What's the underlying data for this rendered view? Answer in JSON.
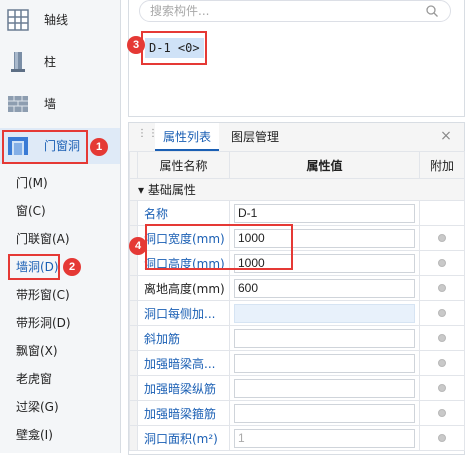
{
  "sidebar": {
    "categories": [
      {
        "label": "轴线",
        "icon": "grid-axis-icon"
      },
      {
        "label": "柱",
        "icon": "column-icon"
      },
      {
        "label": "墙",
        "icon": "wall-icon"
      },
      {
        "label": "门窗洞",
        "icon": "door-window-icon"
      }
    ],
    "items": [
      {
        "label": "门(M)"
      },
      {
        "label": "窗(C)"
      },
      {
        "label": "门联窗(A)"
      },
      {
        "label": "墙洞(D)"
      },
      {
        "label": "带形窗(C)"
      },
      {
        "label": "带形洞(D)"
      },
      {
        "label": "飘窗(X)"
      },
      {
        "label": "老虎窗"
      },
      {
        "label": "过梁(G)"
      },
      {
        "label": "壁龛(I)"
      }
    ]
  },
  "search": {
    "placeholder": "搜索构件..."
  },
  "component_list": [
    {
      "label": "D-1 <0>"
    }
  ],
  "property_panel": {
    "tabs": [
      {
        "label": "属性列表"
      },
      {
        "label": "图层管理"
      }
    ],
    "close_glyph": "×",
    "headers": {
      "name": "属性名称",
      "value": "属性值",
      "extra": "附加"
    },
    "group_toggle": "▾",
    "group_label": "基础属性",
    "rows": [
      {
        "name": "名称",
        "value": "D-1"
      },
      {
        "name": "洞口宽度(mm)",
        "value": "1000"
      },
      {
        "name": "洞口高度(mm)",
        "value": "1000"
      },
      {
        "name": "离地高度(mm)",
        "value": "600"
      },
      {
        "name": "洞口每侧加...",
        "value": ""
      },
      {
        "name": "斜加筋",
        "value": ""
      },
      {
        "name": "加强暗梁高...",
        "value": ""
      },
      {
        "name": "加强暗梁纵筋",
        "value": ""
      },
      {
        "name": "加强暗梁箍筋",
        "value": ""
      },
      {
        "name": "洞口面积(m²)",
        "value": "1"
      }
    ]
  },
  "annotations": [
    {
      "number": "1"
    },
    {
      "number": "2"
    },
    {
      "number": "3"
    },
    {
      "number": "4"
    }
  ],
  "colors": {
    "accent": "#1a5fb4",
    "highlight": "#e53935"
  }
}
